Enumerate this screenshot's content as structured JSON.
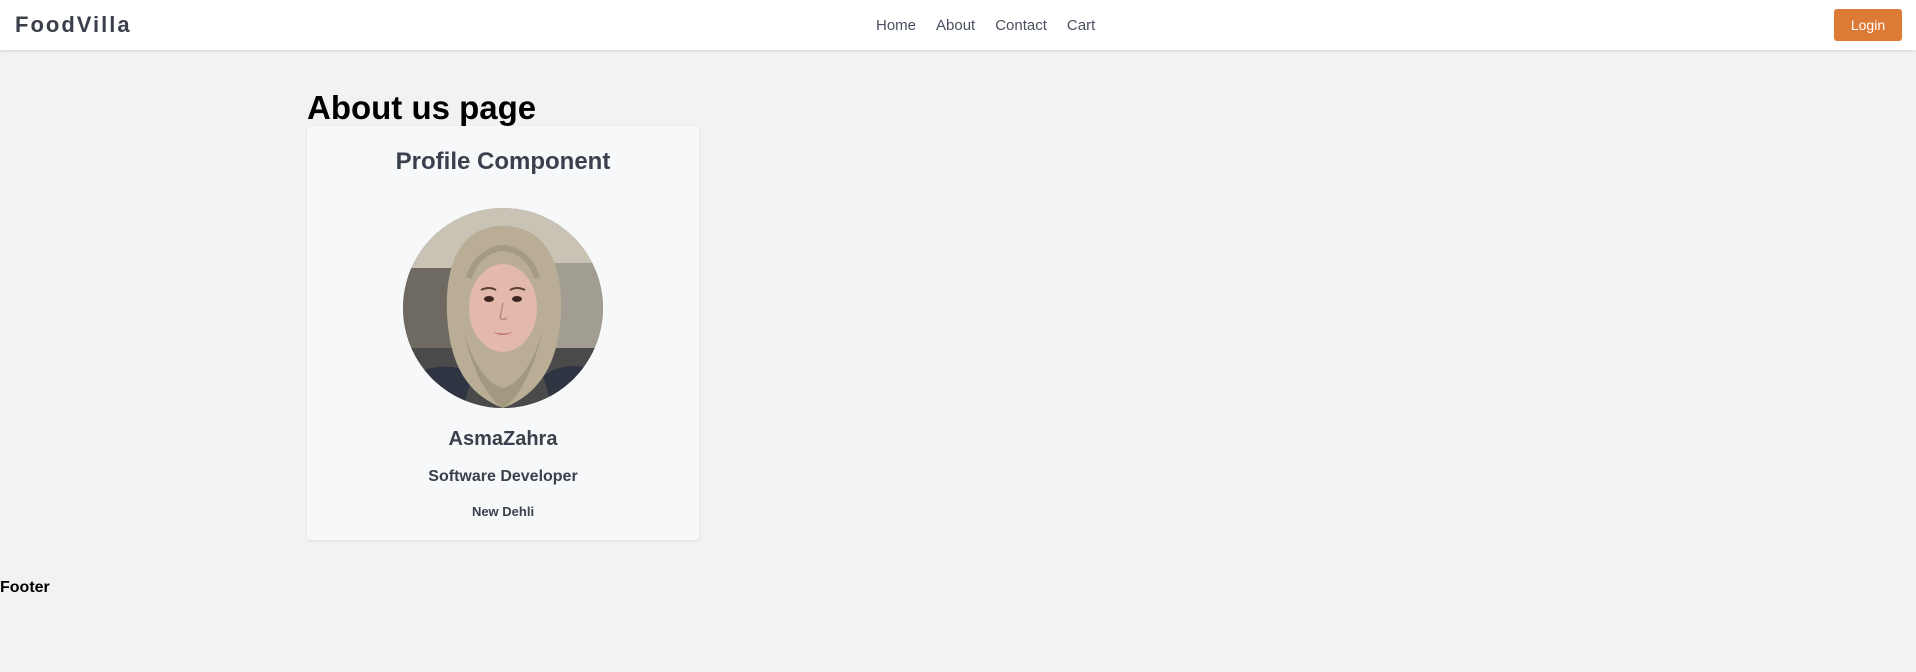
{
  "header": {
    "logo": "FoodVilla",
    "nav": [
      "Home",
      "About",
      "Contact",
      "Cart"
    ],
    "login_label": "Login"
  },
  "main": {
    "title": "About us page",
    "profile": {
      "heading": "Profile Component",
      "name": "AsmaZahra",
      "role": "Software Developer",
      "location": "New Dehli"
    }
  },
  "footer": {
    "text": "Footer"
  },
  "colors": {
    "accent": "#dd7a36",
    "background": "#f1f2f4",
    "card": "#f7f8f9",
    "text_muted": "#3a414c"
  }
}
